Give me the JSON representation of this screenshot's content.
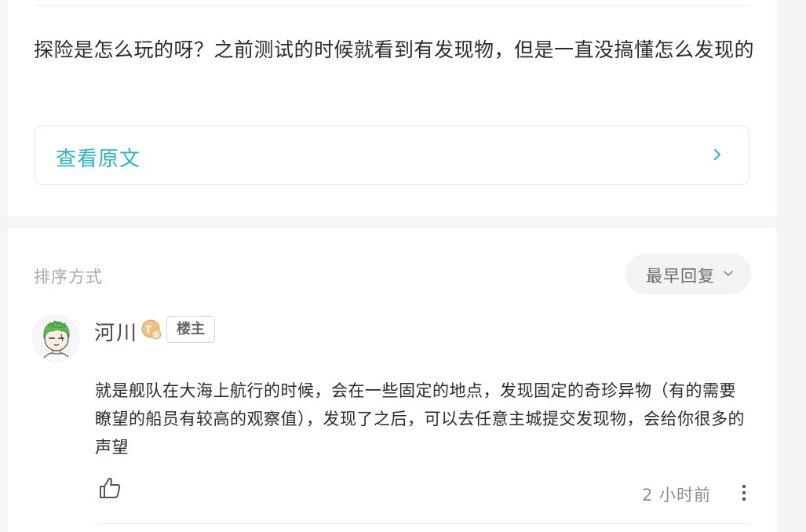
{
  "post": {
    "body_text": "探险是怎么玩的呀？之前测试的时候就看到有发现物，但是一直没搞懂怎么发现的",
    "view_original_label": "查看原文"
  },
  "comments_header": {
    "sort_label": "排序方式",
    "sort_selected": "最早回复"
  },
  "comment": {
    "username": "河川",
    "level_badge": "T5",
    "op_badge": "楼主",
    "text": "就是舰队在大海上航行的时候，会在一些固定的地点，发现固定的奇珍异物（有的需要瞭望的船员有较高的观察值），发现了之后，可以去任意主城提交发现物，会给你很多的声望",
    "timestamp": "2 小时前"
  },
  "colors": {
    "accent": "#2bb6c4",
    "background": "#f4f5f7",
    "card": "#ffffff",
    "text_primary": "#2b2b2b",
    "text_muted": "#a9a9a9",
    "badge_gold": "#e8b26a"
  },
  "icons": {
    "chevron_right": "chevron-right-icon",
    "chevron_down": "chevron-down-icon",
    "like": "thumbs-up-icon",
    "more": "more-vertical-icon",
    "level": "level-badge-icon"
  }
}
